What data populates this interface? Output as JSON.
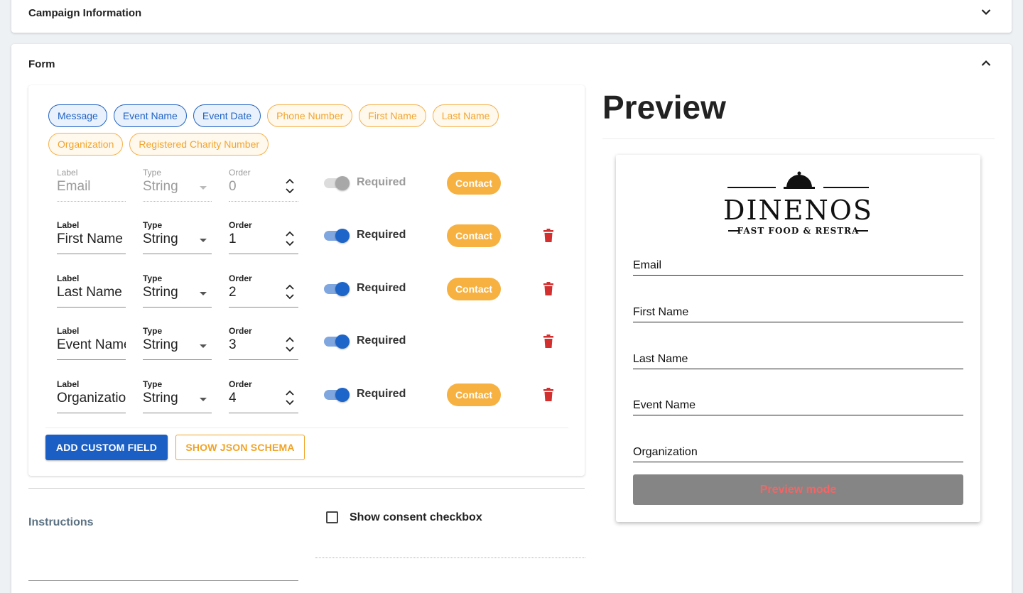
{
  "campaign": {
    "title": "Campaign Information"
  },
  "form": {
    "title": "Form",
    "chips": [
      {
        "label": "Message",
        "style": "blue"
      },
      {
        "label": "Event Name",
        "style": "blue"
      },
      {
        "label": "Event Date",
        "style": "blue"
      },
      {
        "label": "Phone Number",
        "style": "orange"
      },
      {
        "label": "First Name",
        "style": "orange"
      },
      {
        "label": "Last Name",
        "style": "orange"
      },
      {
        "label": "Organization",
        "style": "orange"
      },
      {
        "label": "Registered Charity Number",
        "style": "orange"
      }
    ],
    "field_labels": {
      "label": "Label",
      "type": "Type",
      "order": "Order",
      "required": "Required"
    },
    "rows": [
      {
        "label": "Email",
        "type": "String",
        "order": "0",
        "required": false,
        "tag": "Contact"
      },
      {
        "label": "First Name",
        "type": "String",
        "order": "1",
        "required": true,
        "tag": "Contact"
      },
      {
        "label": "Last Name",
        "type": "String",
        "order": "2",
        "required": true,
        "tag": "Contact"
      },
      {
        "label": "Event Name",
        "type": "String",
        "order": "3",
        "required": true,
        "tag": ""
      },
      {
        "label": "Organization",
        "type": "String",
        "order": "4",
        "required": true,
        "tag": "Contact"
      }
    ],
    "add_button": "ADD CUSTOM FIELD",
    "json_button": "SHOW JSON SCHEMA",
    "instructions": "Instructions",
    "consent_label": "Show consent checkbox"
  },
  "preview": {
    "title": "Preview",
    "logo_name": "DINENOS",
    "logo_sub": "FAST FOOD & RESTRA",
    "fields": [
      "Email",
      "First Name",
      "Last Name",
      "Event Name",
      "Organization"
    ],
    "button": "Preview mode"
  },
  "colors": {
    "primary": "#1c5fc4",
    "accent": "#f6b141",
    "danger": "#d32f2f"
  }
}
